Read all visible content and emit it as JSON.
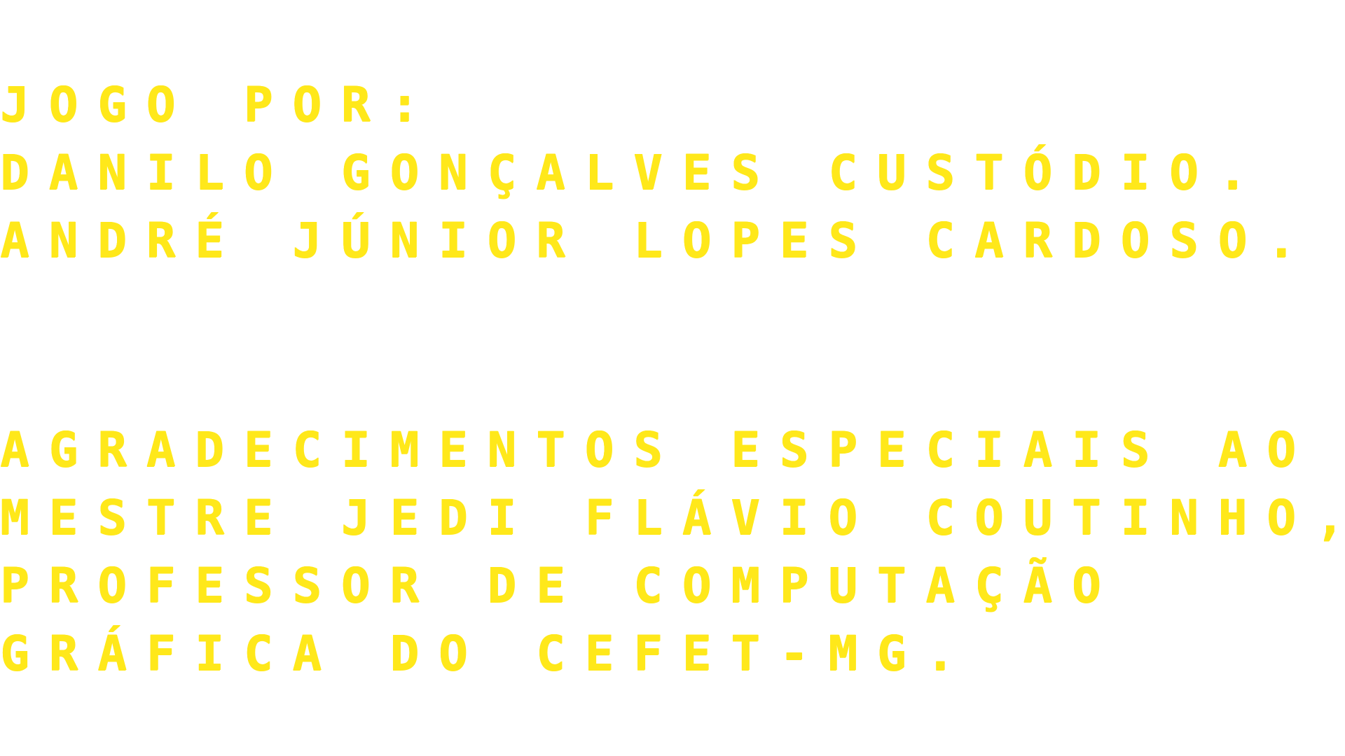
{
  "theme": {
    "background": "#ffffff",
    "text_color": "#ffe81a"
  },
  "credits": {
    "authors": {
      "heading": "JOGO POR:",
      "names": [
        "DANILO GONÇALVES CUSTÓDIO.",
        "ANDRÉ JÚNIOR LOPES CARDOSO."
      ]
    },
    "thanks": {
      "lines": [
        "AGRADECIMENTOS ESPECIAIS AO",
        "MESTRE JEDI FLÁVIO COUTINHO,",
        "PROFESSOR DE COMPUTAÇÃO",
        "GRÁFICA DO CEFET-MG."
      ]
    }
  }
}
